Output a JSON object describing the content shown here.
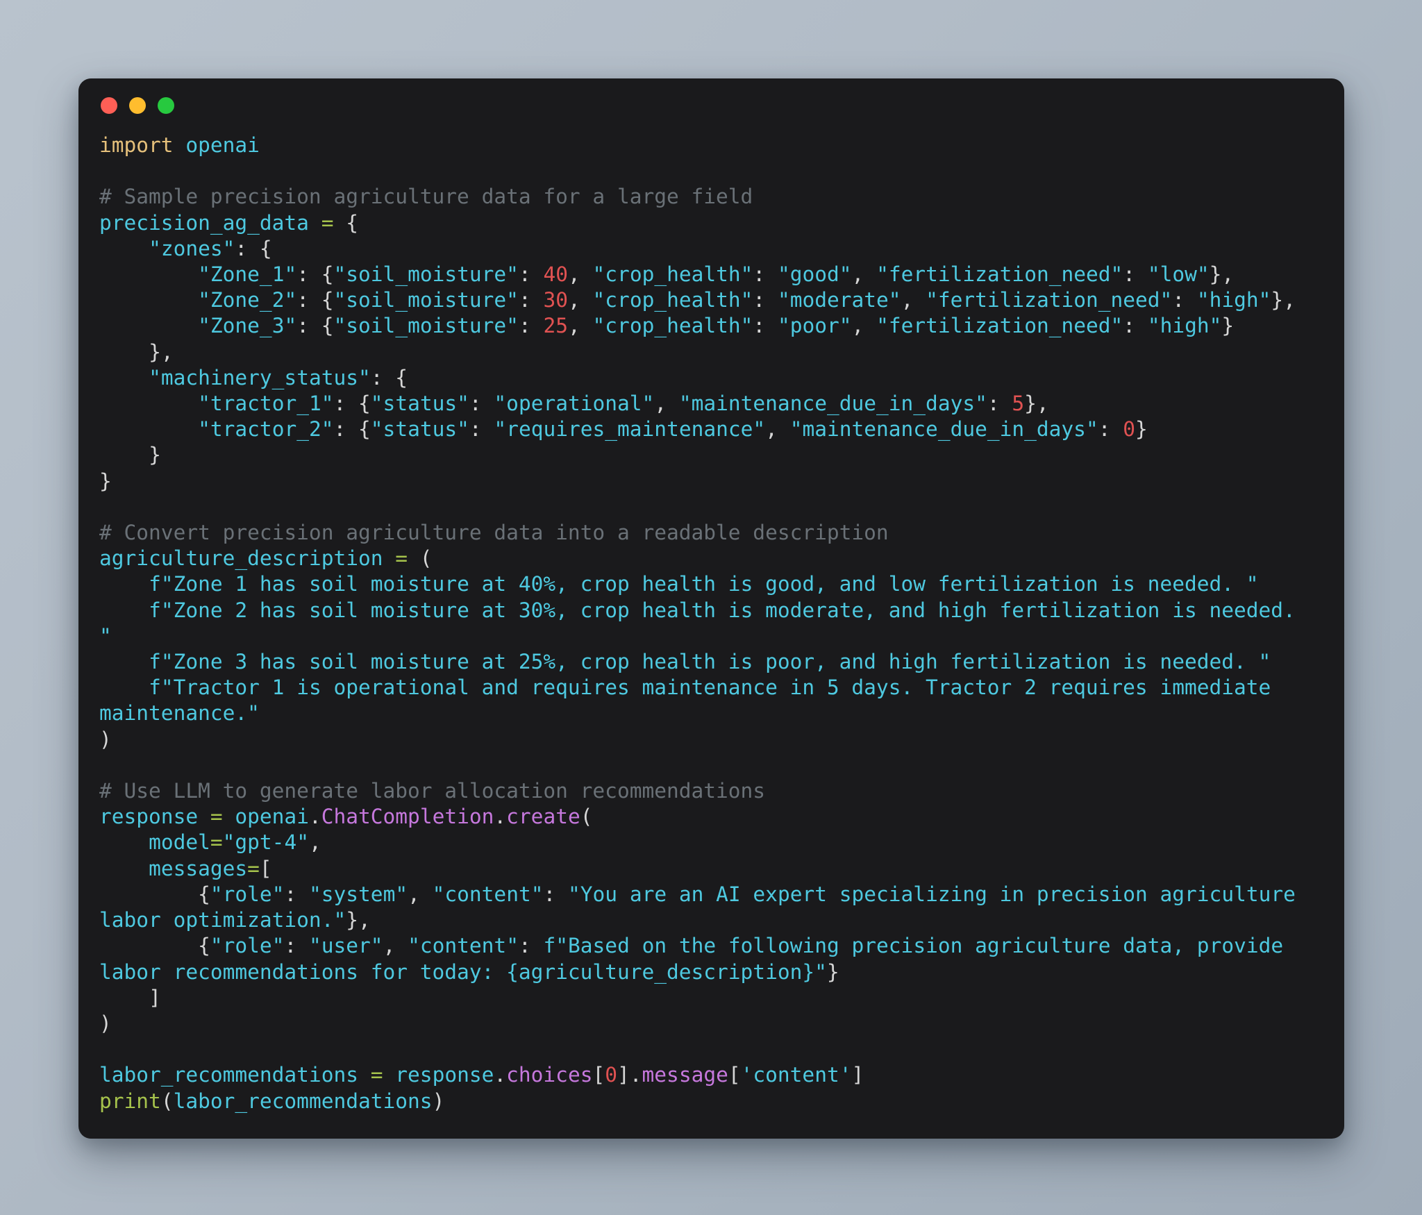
{
  "window": {
    "background_color": "#1a1a1c",
    "page_background_colors": [
      "#b9c3cd",
      "#9fabb8"
    ],
    "traffic_lights": [
      {
        "name": "close",
        "color": "#ff5f56"
      },
      {
        "name": "minimize",
        "color": "#ffbd2e"
      },
      {
        "name": "maximize",
        "color": "#27c93f"
      }
    ]
  },
  "syntax_colors": {
    "keyword": "#e5c07b",
    "identifier": "#4ec9e0",
    "string": "#4ec9e0",
    "comment": "#6a7177",
    "number": "#e05252",
    "operator": "#a6c34c",
    "attribute": "#c678dd",
    "builtin": "#a6c34c",
    "punctuation": "#d6d6d6"
  },
  "code": {
    "language": "python",
    "lines": [
      {
        "id": "l1",
        "text": "import openai"
      },
      {
        "id": "l2",
        "text": ""
      },
      {
        "id": "l3",
        "text": "# Sample precision agriculture data for a large field"
      },
      {
        "id": "l4",
        "text": "precision_ag_data = {"
      },
      {
        "id": "l5",
        "text": "    \"zones\": {"
      },
      {
        "id": "l6",
        "text": "        \"Zone_1\": {\"soil_moisture\": 40, \"crop_health\": \"good\", \"fertilization_need\": \"low\"},"
      },
      {
        "id": "l7",
        "text": "        \"Zone_2\": {\"soil_moisture\": 30, \"crop_health\": \"moderate\", \"fertilization_need\": \"high\"},"
      },
      {
        "id": "l8",
        "text": "        \"Zone_3\": {\"soil_moisture\": 25, \"crop_health\": \"poor\", \"fertilization_need\": \"high\"}"
      },
      {
        "id": "l9",
        "text": "    },"
      },
      {
        "id": "l10",
        "text": "    \"machinery_status\": {"
      },
      {
        "id": "l11",
        "text": "        \"tractor_1\": {\"status\": \"operational\", \"maintenance_due_in_days\": 5},"
      },
      {
        "id": "l12",
        "text": "        \"tractor_2\": {\"status\": \"requires_maintenance\", \"maintenance_due_in_days\": 0}"
      },
      {
        "id": "l13",
        "text": "    }"
      },
      {
        "id": "l14",
        "text": "}"
      },
      {
        "id": "l15",
        "text": ""
      },
      {
        "id": "l16",
        "text": "# Convert precision agriculture data into a readable description"
      },
      {
        "id": "l17",
        "text": "agriculture_description = ("
      },
      {
        "id": "l18",
        "text": "    f\"Zone 1 has soil moisture at 40%, crop health is good, and low fertilization is needed. \""
      },
      {
        "id": "l19",
        "text": "    f\"Zone 2 has soil moisture at 30%, crop health is moderate, and high fertilization is needed. \""
      },
      {
        "id": "l20",
        "text": "    f\"Zone 3 has soil moisture at 25%, crop health is poor, and high fertilization is needed. \""
      },
      {
        "id": "l21",
        "text": "    f\"Tractor 1 is operational and requires maintenance in 5 days. Tractor 2 requires immediate maintenance.\""
      },
      {
        "id": "l22",
        "text": ")"
      },
      {
        "id": "l23",
        "text": ""
      },
      {
        "id": "l24",
        "text": "# Use LLM to generate labor allocation recommendations"
      },
      {
        "id": "l25",
        "text": "response = openai.ChatCompletion.create("
      },
      {
        "id": "l26",
        "text": "    model=\"gpt-4\","
      },
      {
        "id": "l27",
        "text": "    messages=["
      },
      {
        "id": "l28",
        "text": "        {\"role\": \"system\", \"content\": \"You are an AI expert specializing in precision agriculture labor optimization.\"},"
      },
      {
        "id": "l29",
        "text": "        {\"role\": \"user\", \"content\": f\"Based on the following precision agriculture data, provide labor recommendations for today: {agriculture_description}\"}"
      },
      {
        "id": "l30",
        "text": "    ]"
      },
      {
        "id": "l31",
        "text": ")"
      },
      {
        "id": "l32",
        "text": ""
      },
      {
        "id": "l33",
        "text": "labor_recommendations = response.choices[0].message['content']"
      },
      {
        "id": "l34",
        "text": "print(labor_recommendations)"
      }
    ],
    "data_values": {
      "zones": {
        "Zone_1": {
          "soil_moisture": 40,
          "crop_health": "good",
          "fertilization_need": "low"
        },
        "Zone_2": {
          "soil_moisture": 30,
          "crop_health": "moderate",
          "fertilization_need": "high"
        },
        "Zone_3": {
          "soil_moisture": 25,
          "crop_health": "poor",
          "fertilization_need": "high"
        }
      },
      "machinery_status": {
        "tractor_1": {
          "status": "operational",
          "maintenance_due_in_days": 5
        },
        "tractor_2": {
          "status": "requires_maintenance",
          "maintenance_due_in_days": 0
        }
      },
      "model": "gpt-4"
    }
  }
}
